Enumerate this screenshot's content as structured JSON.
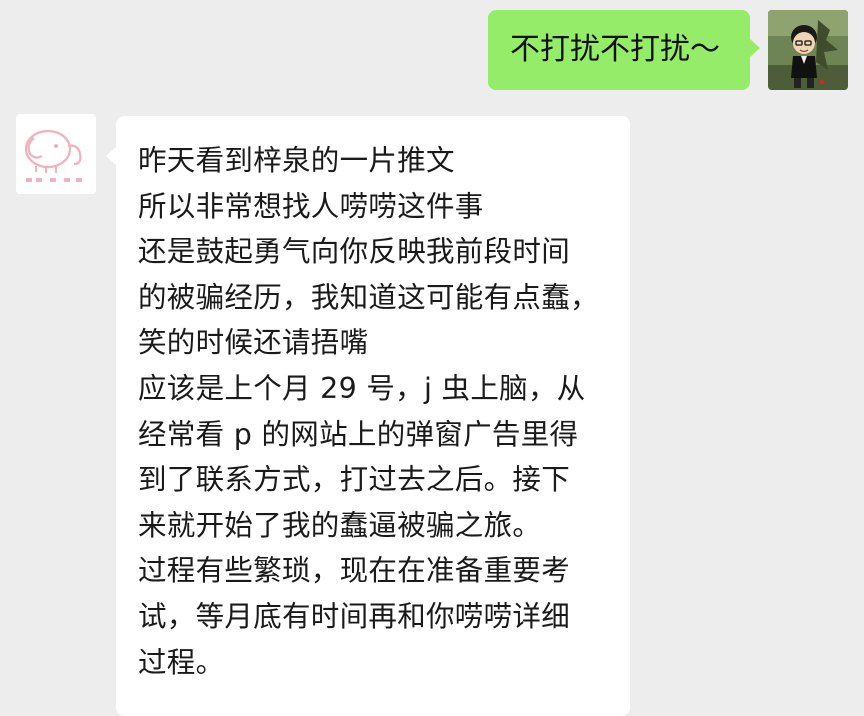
{
  "outgoing": {
    "text": "不打扰不打扰～"
  },
  "incoming": {
    "lines": [
      "昨天看到梓泉的一片推文",
      "所以非常想找人唠唠这件事",
      "还是鼓起勇气向你反映我前段时间",
      "的被骗经历，我知道这可能有点蠢，",
      "笑的时候还请捂嘴",
      "应该是上个月 29 号，j 虫上脑，从",
      "经常看 p 的网站上的弹窗广告里得",
      "到了联系方式，打过去之后。接下",
      "来就开始了我的蠢逼被骗之旅。",
      "过程有些繁琐，现在在准备重要考",
      "试，等月底有时间再和你唠唠详细",
      "过程。"
    ]
  },
  "colors": {
    "background": "#ededed",
    "outgoing_bubble": "#95ec69",
    "incoming_bubble": "#ffffff",
    "elephant_pink": "#f3b0bf"
  },
  "icons": {
    "self_avatar": "cartoon-man-avatar",
    "other_avatar": "pink-elephant-avatar"
  }
}
